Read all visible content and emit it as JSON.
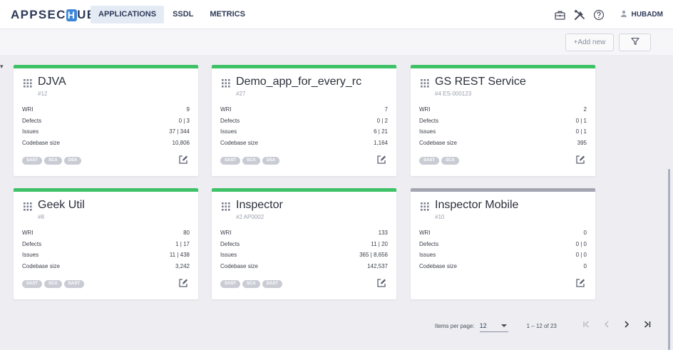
{
  "header": {
    "logo_pre": "APPSEC",
    "logo_mark": "H",
    "logo_post": "UB",
    "tabs": [
      {
        "label": "APPLICATIONS",
        "active": true
      },
      {
        "label": "SSDL",
        "active": false
      },
      {
        "label": "METRICS",
        "active": false
      }
    ],
    "icons": [
      "briefcase-icon",
      "tools-icon",
      "help-icon"
    ],
    "user": "HUBADM"
  },
  "toolbar": {
    "add_label": "+Add new",
    "filter_icon": "filter-icon"
  },
  "metric_labels": [
    "WRI",
    "Defects",
    "Issues",
    "Codebase size"
  ],
  "colors": {
    "active_bar": "#3fc267",
    "inactive_bar": "#a3a6b2",
    "tag_bg": "#c9ccd4"
  },
  "apps": [
    {
      "name": "DJVA",
      "id": "#12",
      "status": "active",
      "wri": "9",
      "defects": "0 | 3",
      "issues": "37 | 344",
      "codebase": "10,806",
      "tags": [
        "SAST",
        "SCA",
        "DSA"
      ]
    },
    {
      "name": "Demo_app_for_every_rc",
      "id": "#27",
      "status": "active",
      "wri": "7",
      "defects": "0 | 2",
      "issues": "6 | 21",
      "codebase": "1,164",
      "tags": [
        "SAST",
        "SCA",
        "DSA"
      ]
    },
    {
      "name": "GS REST Service",
      "id": "#4 ES-000123",
      "status": "active",
      "wri": "2",
      "defects": "0 | 1",
      "issues": "0 | 1",
      "codebase": "395",
      "tags": [
        "SAST",
        "SCA"
      ]
    },
    {
      "name": "Geek Util",
      "id": "#8",
      "status": "active",
      "wri": "80",
      "defects": "1 | 17",
      "issues": "11 | 438",
      "codebase": "3,242",
      "tags": [
        "SAST",
        "SCA",
        "DAST"
      ]
    },
    {
      "name": "Inspector",
      "id": "#2 AP0002",
      "status": "active",
      "wri": "133",
      "defects": "11 | 20",
      "issues": "365 | 8,656",
      "codebase": "142,537",
      "tags": [
        "SAST",
        "SCA",
        "DAST"
      ]
    },
    {
      "name": "Inspector Mobile",
      "id": "#10",
      "status": "inactive",
      "wri": "0",
      "defects": "0 | 0",
      "issues": "0 | 0",
      "codebase": "0",
      "tags": []
    }
  ],
  "pagination": {
    "items_per_page_label": "Items per page:",
    "items_per_page": "12",
    "range": "1 – 12 of 23",
    "icons": [
      "first-page-icon",
      "prev-page-icon",
      "next-page-icon",
      "last-page-icon"
    ]
  }
}
